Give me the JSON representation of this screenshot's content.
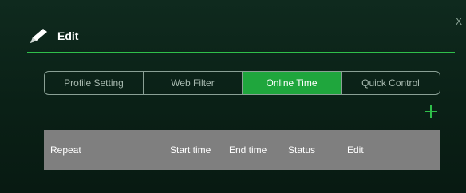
{
  "dialog": {
    "title": "Edit",
    "close_label": "X",
    "accent": "#2fbf4a"
  },
  "tabs": [
    {
      "label": "Profile Setting",
      "active": false
    },
    {
      "label": "Web Filter",
      "active": false
    },
    {
      "label": "Online Time",
      "active": true
    },
    {
      "label": "Quick Control",
      "active": false
    }
  ],
  "add_button": {
    "icon": "plus-icon"
  },
  "table": {
    "columns": [
      "Repeat",
      "Start time",
      "End time",
      "Status",
      "Edit"
    ]
  }
}
